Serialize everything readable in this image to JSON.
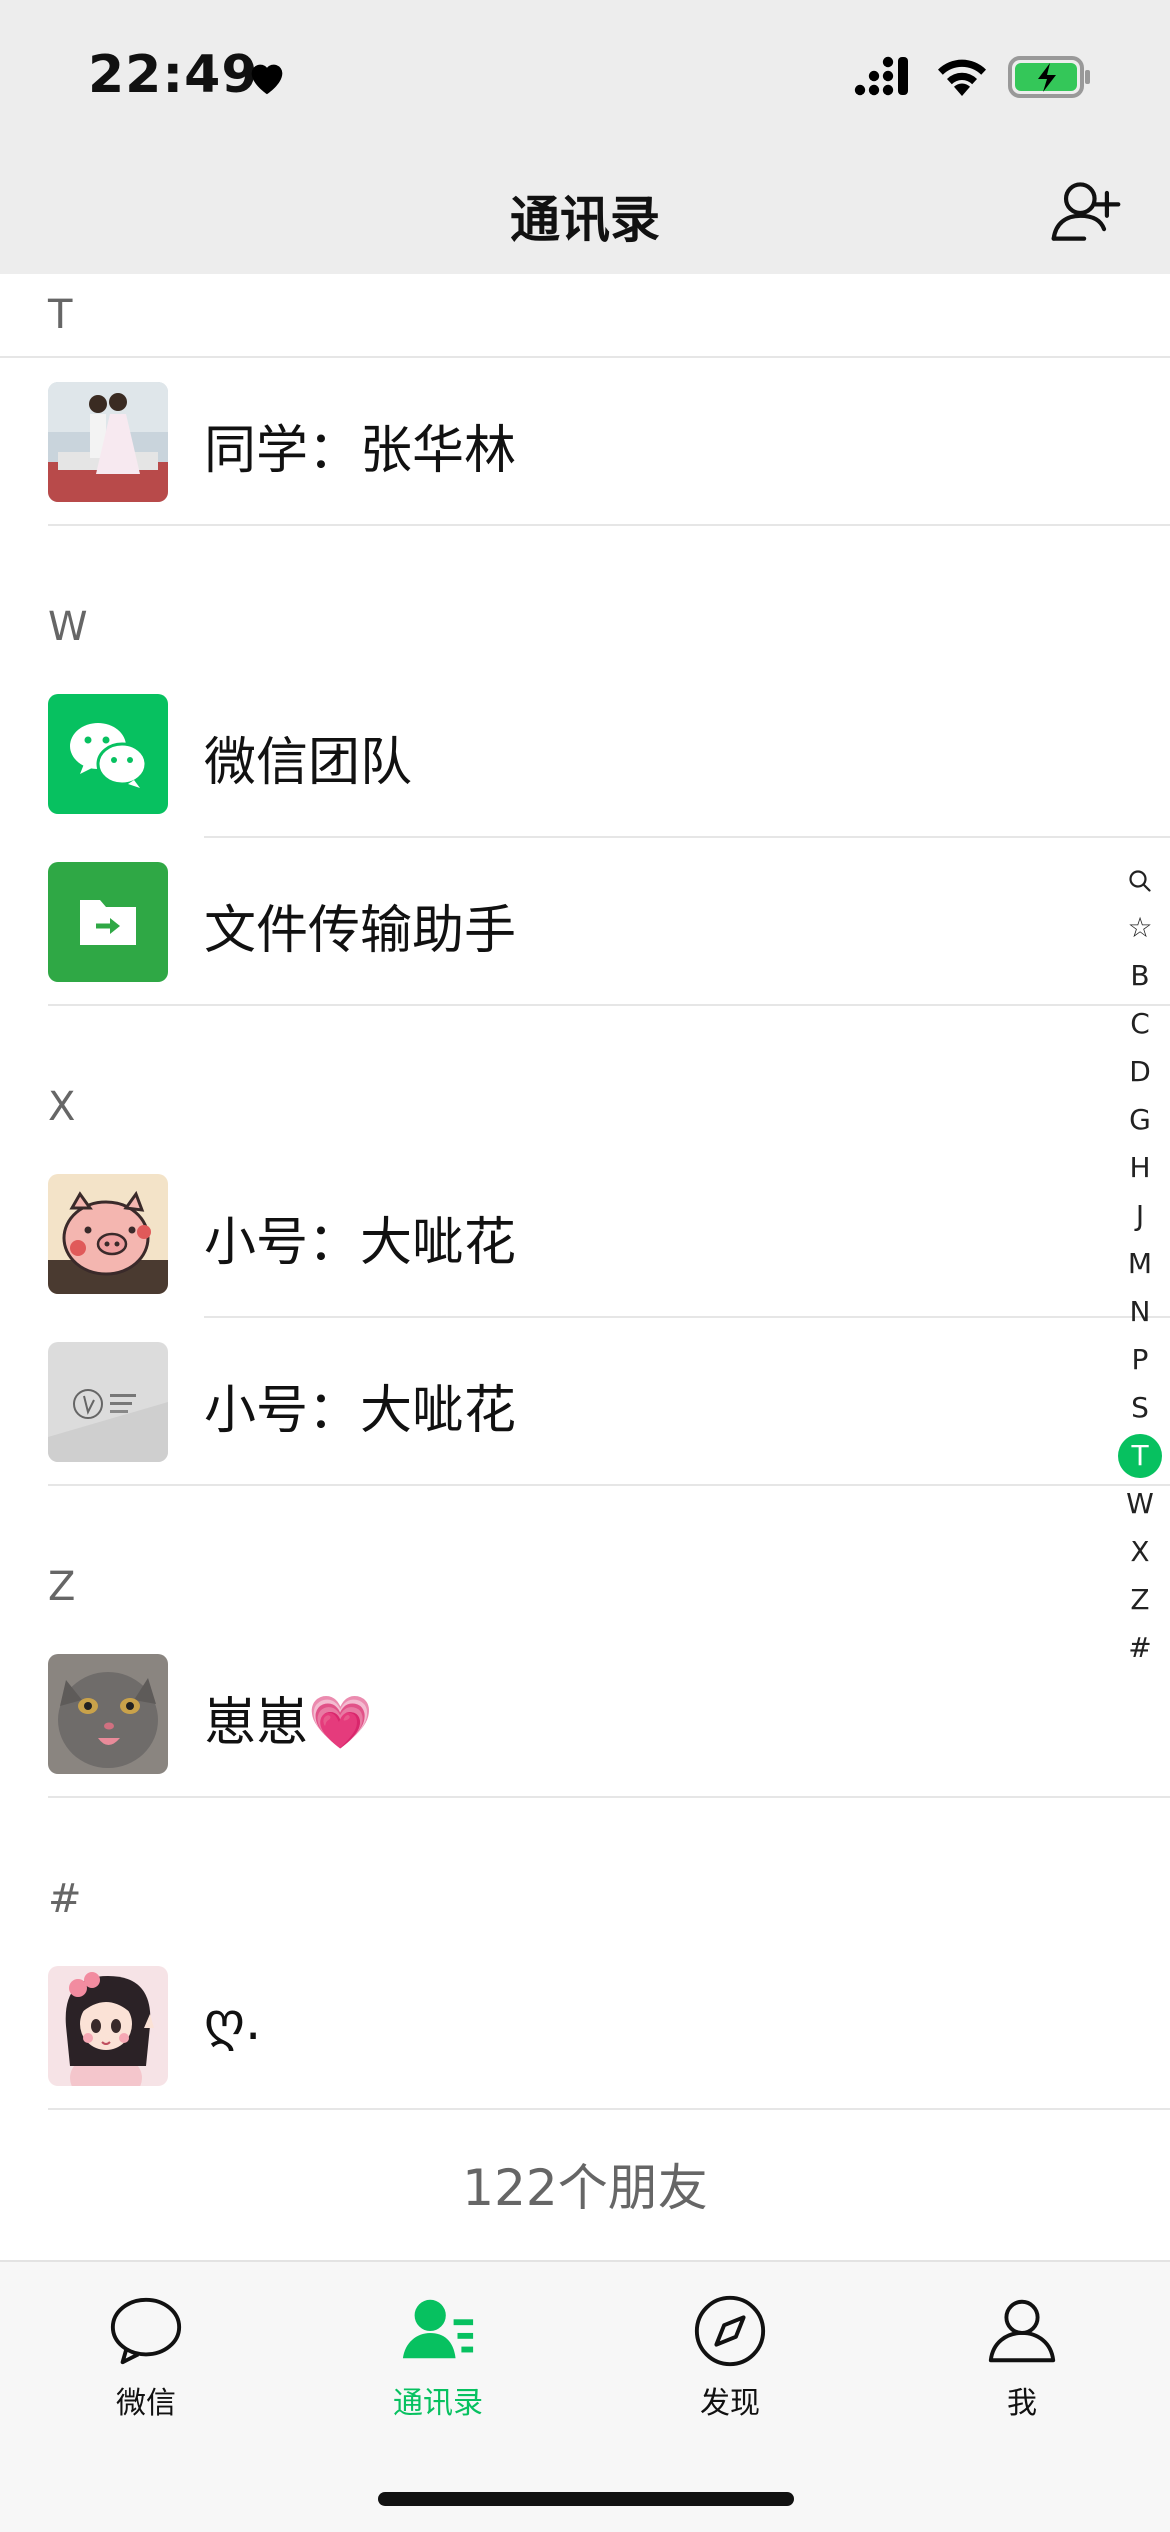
{
  "status_bar": {
    "time": "22:49"
  },
  "nav": {
    "title": "通讯录"
  },
  "sections": {
    "t": {
      "letter": "T",
      "contact_name": "同学：张华林"
    },
    "w": {
      "letter": "W",
      "contact_1_name": "微信团队",
      "contact_2_name": "文件传输助手"
    },
    "x": {
      "letter": "X",
      "contact_1_name": "小号：大呲花",
      "contact_2_name": "小号：大呲花"
    },
    "z": {
      "letter": "Z",
      "contact_name": "崽崽💗"
    },
    "hash": {
      "letter": "#",
      "contact_name": "ღ."
    }
  },
  "index_bar": [
    "Q",
    "☆",
    "B",
    "C",
    "D",
    "G",
    "H",
    "J",
    "M",
    "N",
    "P",
    "S",
    "T",
    "W",
    "X",
    "Z",
    "#"
  ],
  "index_active": "T",
  "friend_count": "122个朋友",
  "tabs": {
    "chats": "微信",
    "contacts": "通讯录",
    "discover": "发现",
    "me": "我"
  },
  "colors": {
    "accent": "#07c160",
    "wechat_team_bg": "#07c160",
    "file_transfer_bg": "#2fa845"
  }
}
